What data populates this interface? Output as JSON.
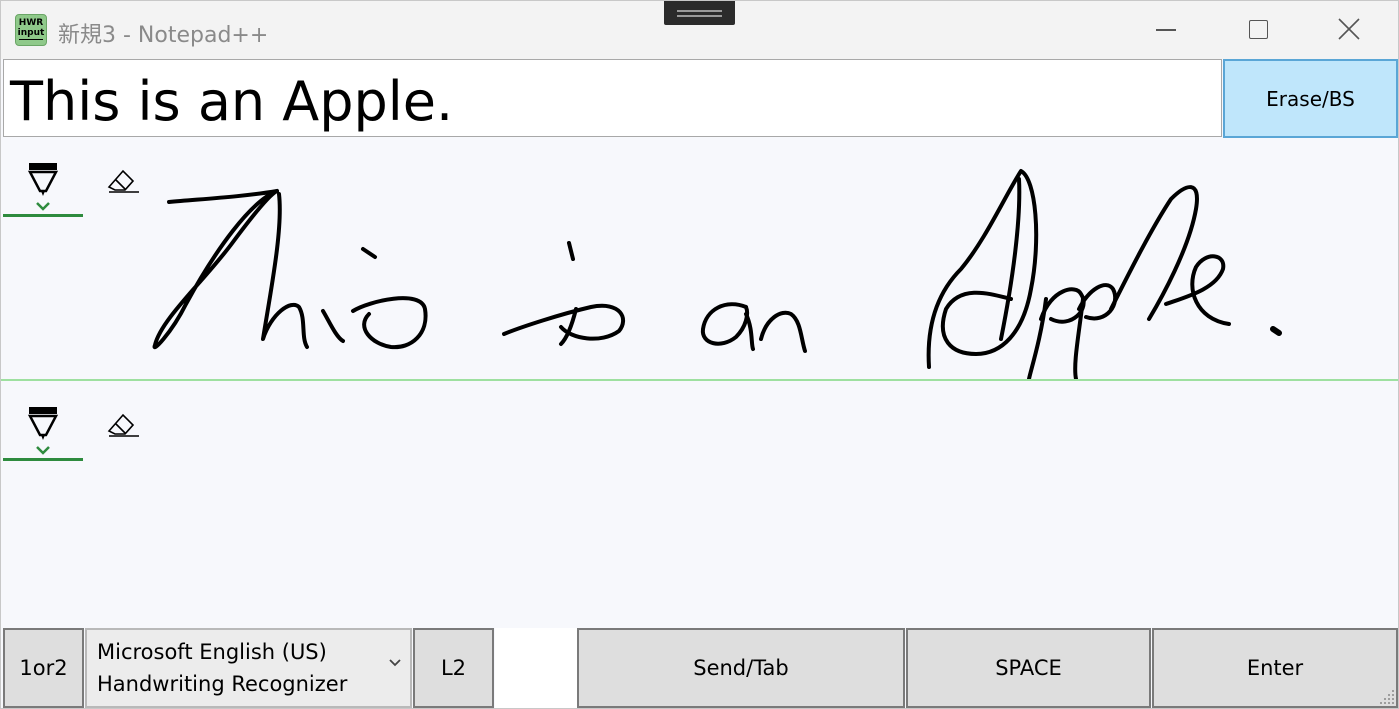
{
  "titlebar": {
    "icon_line1": "HWR",
    "icon_line2": "input",
    "title": "新規3 - Notepad++",
    "minimize_icon": "minimize-icon",
    "maximize_icon": "maximize-icon",
    "close_icon": "close-icon"
  },
  "result": {
    "text": "This is an Apple.",
    "erase_label": "Erase/BS"
  },
  "canvas1": {
    "tools": [
      "pen-icon",
      "eraser-icon"
    ],
    "ink_text": "This is an Apple."
  },
  "canvas2": {
    "tools": [
      "pen-icon",
      "eraser-icon"
    ]
  },
  "bottom": {
    "mode_label": "1or2",
    "recognizer_line1": "Microsoft English (US)",
    "recognizer_line2": "Handwriting Recognizer",
    "l2_label": "L2",
    "send_label": "Send/Tab",
    "space_label": "SPACE",
    "enter_label": "Enter"
  },
  "colors": {
    "erase_bg": "#bfe6fb",
    "erase_border": "#5aa6d6",
    "divider": "#9ee0a0",
    "tool_underline": "#2e8b3e",
    "icon_bg": "#8fc98a"
  }
}
